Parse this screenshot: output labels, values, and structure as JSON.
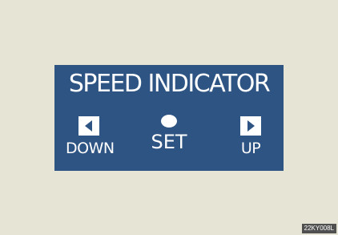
{
  "panel": {
    "title": "SPEED INDICATOR",
    "controls": {
      "down": {
        "label": "DOWN",
        "icon": "left-triangle-icon"
      },
      "set": {
        "label": "SET",
        "icon": "dot-icon"
      },
      "up": {
        "label": "UP",
        "icon": "right-triangle-icon"
      }
    }
  },
  "image_code": "22KY008L",
  "colors": {
    "background": "#e6e4d5",
    "panel": "#2e5483",
    "foreground": "#ffffff"
  }
}
